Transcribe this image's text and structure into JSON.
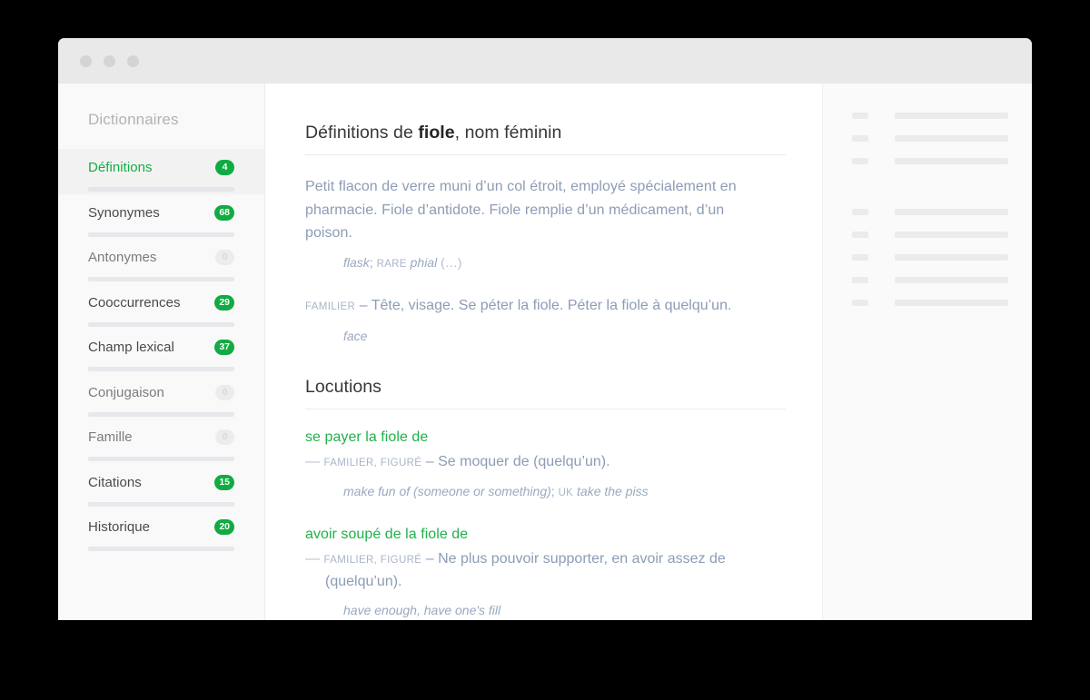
{
  "window": {
    "traffic_lights": [
      "close-dot",
      "minimize-dot",
      "zoom-dot"
    ]
  },
  "sidebar": {
    "title": "Dictionnaires",
    "items": [
      {
        "label": "Définitions",
        "count": "4",
        "active": true,
        "zero": false
      },
      {
        "label": "Synonymes",
        "count": "68",
        "active": false,
        "zero": false
      },
      {
        "label": "Antonymes",
        "count": "0",
        "active": false,
        "zero": true
      },
      {
        "label": "Cooccurrences",
        "count": "29",
        "active": false,
        "zero": false
      },
      {
        "label": "Champ lexical",
        "count": "37",
        "active": false,
        "zero": false
      },
      {
        "label": "Conjugaison",
        "count": "0",
        "active": false,
        "zero": true
      },
      {
        "label": "Famille",
        "count": "0",
        "active": false,
        "zero": true
      },
      {
        "label": "Citations",
        "count": "15",
        "active": false,
        "zero": false
      },
      {
        "label": "Historique",
        "count": "20",
        "active": false,
        "zero": false
      }
    ]
  },
  "main": {
    "definitions_heading_prefix": "Définitions de ",
    "definitions_heading_word": "fiole",
    "definitions_heading_suffix": ", nom féminin",
    "definition_1": "Petit flacon de verre muni d’un col étroit, employé spécialement en pharmacie. Fiole d’antidote. Fiole remplie d’un médicament, d’un poison.",
    "definition_1_translation": {
      "term_1": "flask",
      "separator": ";",
      "register": "RARE",
      "term_2": "phial",
      "more": "(…)"
    },
    "definition_2": {
      "register": "FAMILIER",
      "dash": "–",
      "text": "Tête, visage. Se péter la fiole. Péter la fiole à quelqu’un.",
      "translation": "face"
    },
    "locutions_heading": "Locutions",
    "locutions": [
      {
        "term": "se payer la fiole de",
        "bullet": "—",
        "registers": "FAMILIER, FIGURÉ",
        "dash": "–",
        "definition": "Se moquer de (quelqu’un).",
        "translation_1": "make fun of (someone or something)",
        "translation_separator": ";",
        "translation_region": "UK",
        "translation_2": "take the piss"
      },
      {
        "term": "avoir soupé de la fiole de",
        "bullet": "—",
        "registers": "FAMILIER, FIGURÉ",
        "dash": "–",
        "definition": "Ne plus pouvoir supporter, en avoir assez de (quelqu’un).",
        "translation_1": "have enough, have one's fill",
        "translation_separator": "",
        "translation_region": "",
        "translation_2": ""
      }
    ]
  },
  "right_panel": {
    "placeholder_rows": [
      {
        "group_end": false
      },
      {
        "group_end": false
      },
      {
        "group_end": true
      },
      {
        "group_end": false
      },
      {
        "group_end": false
      },
      {
        "group_end": false
      },
      {
        "group_end": false
      },
      {
        "group_end": false
      }
    ]
  },
  "colors": {
    "accent_green": "#10ab42",
    "link_green": "#21b04b",
    "body_text": "#8d9cb5",
    "heading": "#373737",
    "sidebar_bg": "#f9f9f9"
  }
}
